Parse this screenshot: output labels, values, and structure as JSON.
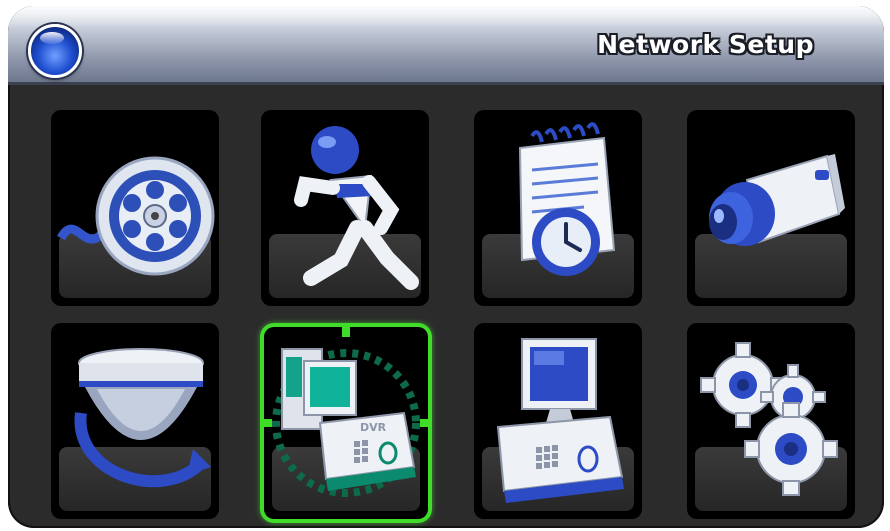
{
  "window": {
    "title": "Network Setup",
    "accent_color": "#3fdc2a",
    "header_icon": "blue-orb-icon"
  },
  "menu": {
    "items": [
      {
        "icon": "film-reel-icon",
        "selected": false
      },
      {
        "icon": "running-figure-icon",
        "selected": false
      },
      {
        "icon": "notepad-clock-icon",
        "selected": false
      },
      {
        "icon": "camera-icon",
        "selected": false
      },
      {
        "icon": "dome-camera-rotate-icon",
        "selected": false
      },
      {
        "icon": "network-dvr-icon",
        "selected": true
      },
      {
        "icon": "computer-dvr-icon",
        "selected": false
      },
      {
        "icon": "gears-icon",
        "selected": false
      }
    ]
  },
  "labels": {
    "dvr_box_text": "DVR"
  }
}
